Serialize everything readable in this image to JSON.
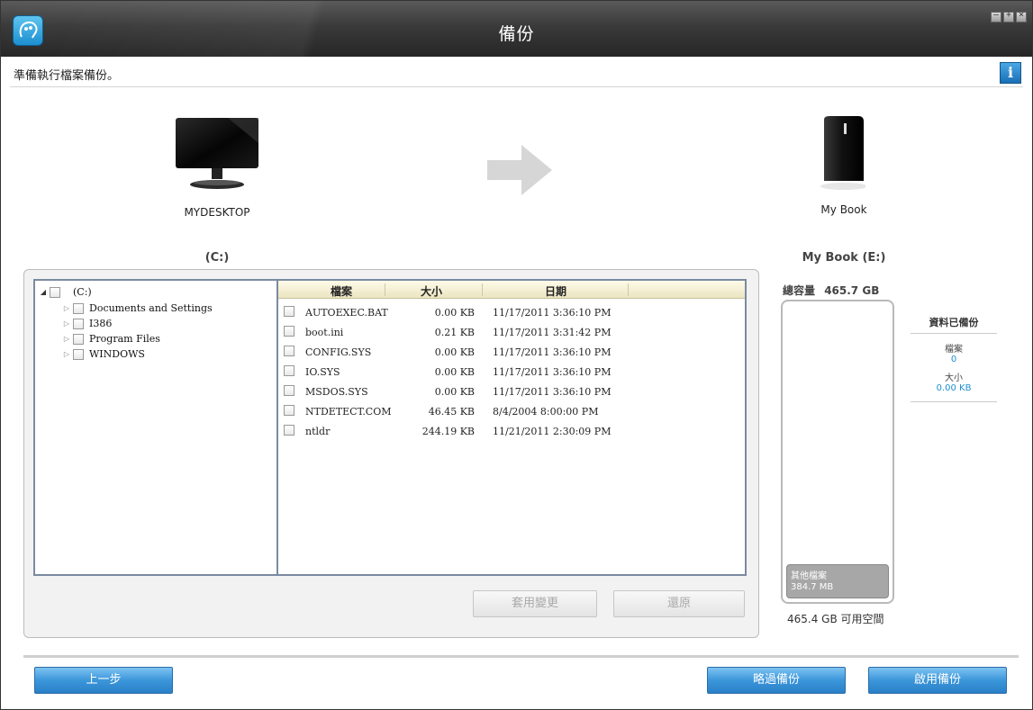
{
  "window": {
    "title": "備份"
  },
  "infobar": {
    "message": "準備執行檔案備份。",
    "info_label": "i"
  },
  "source": {
    "device_name": "MYDESKTOP",
    "drive_label": "(C:)"
  },
  "target": {
    "device_name": "My Book",
    "drive_label": "My Book (E:)"
  },
  "tree": {
    "root": "(C:)",
    "items": [
      {
        "label": "Documents and Settings"
      },
      {
        "label": "I386"
      },
      {
        "label": "Program Files"
      },
      {
        "label": "WINDOWS"
      }
    ]
  },
  "file_list": {
    "columns": {
      "name": "檔案",
      "size": "大小",
      "date": "日期"
    },
    "rows": [
      {
        "name": "AUTOEXEC.BAT",
        "size": "0.00 KB",
        "date": "11/17/2011 3:36:10 PM"
      },
      {
        "name": "boot.ini",
        "size": "0.21 KB",
        "date": "11/17/2011 3:31:42 PM"
      },
      {
        "name": "CONFIG.SYS",
        "size": "0.00 KB",
        "date": "11/17/2011 3:36:10 PM"
      },
      {
        "name": "IO.SYS",
        "size": "0.00 KB",
        "date": "11/17/2011 3:36:10 PM"
      },
      {
        "name": "MSDOS.SYS",
        "size": "0.00 KB",
        "date": "11/17/2011 3:36:10 PM"
      },
      {
        "name": "NTDETECT.COM",
        "size": "46.45 KB",
        "date": "8/4/2004 8:00:00 PM"
      },
      {
        "name": "ntldr",
        "size": "244.19 KB",
        "date": "11/21/2011 2:30:09 PM"
      }
    ]
  },
  "panel_buttons": {
    "apply": "套用變更",
    "restore": "還原"
  },
  "capacity": {
    "total_label": "總容量",
    "total_value": "465.7 GB",
    "other_files_label": "其他檔案",
    "other_files_value": "384.7 MB",
    "free_label": "465.4 GB 可用空間"
  },
  "summary": {
    "heading": "資料已備份",
    "files_label": "檔案",
    "files_value": "0",
    "size_label": "大小",
    "size_value": "0.00 KB"
  },
  "footer": {
    "back": "上一步",
    "skip": "略過備份",
    "start": "啟用備份"
  },
  "colors": {
    "accent": "#1d8fd0",
    "title_bar": "#2f2f2f",
    "button_blue": "#3b96da"
  }
}
